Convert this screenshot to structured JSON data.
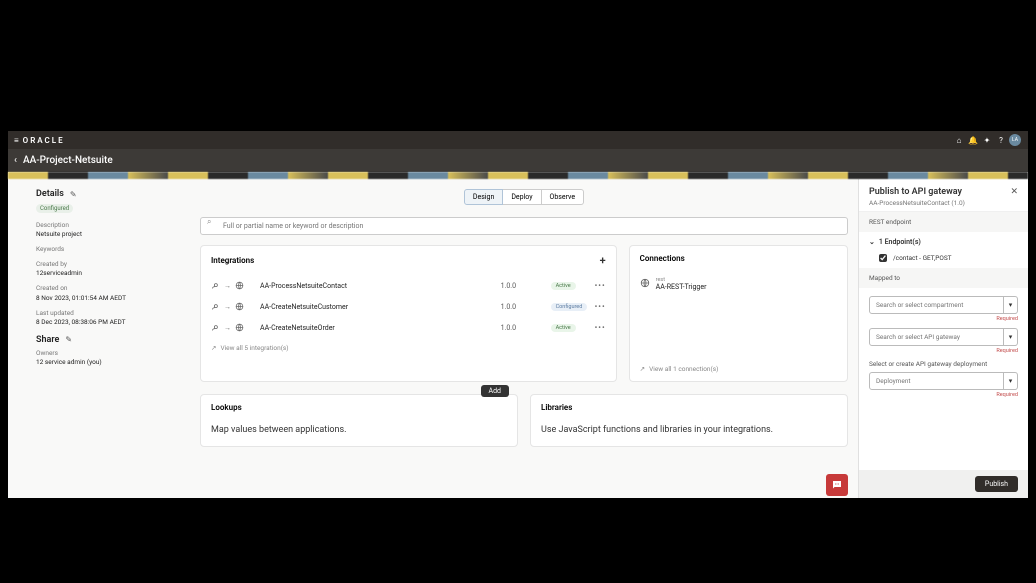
{
  "brand": "ORACLE",
  "userBadge": "LA",
  "pageTitle": "AA-Project-Netsuite",
  "tabs": {
    "design": "Design",
    "deploy": "Deploy",
    "observe": "Observe"
  },
  "search": {
    "placeholder": "Full or partial name or keyword or description"
  },
  "details": {
    "heading": "Details",
    "statusBadge": "Configured",
    "description": {
      "label": "Description",
      "value": "Netsuite project"
    },
    "keywords": {
      "label": "Keywords",
      "value": ""
    },
    "createdBy": {
      "label": "Created by",
      "value": "12serviceadmin"
    },
    "createdOn": {
      "label": "Created on",
      "value": "8 Nov 2023, 01:01:54 AM AEDT"
    },
    "lastUpdated": {
      "label": "Last updated",
      "value": "8 Dec 2023, 08:38:06 PM AEDT"
    },
    "share": {
      "heading": "Share",
      "ownersLabel": "Owners",
      "ownersValue": "12 service admin (you)"
    }
  },
  "integrations": {
    "title": "Integrations",
    "rows": [
      {
        "name": "AA-ProcessNetsuiteContact",
        "version": "1.0.0",
        "status": "Active"
      },
      {
        "name": "AA-CreateNetsuiteCustomer",
        "version": "1.0.0",
        "status": "Configured"
      },
      {
        "name": "AA-CreateNetsuiteOrder",
        "version": "1.0.0",
        "status": "Active"
      }
    ],
    "viewAll": "View all 5 integration(s)"
  },
  "connections": {
    "title": "Connections",
    "rows": [
      {
        "sub": "rest",
        "name": "AA-REST-Trigger"
      }
    ],
    "viewAll": "View all 1 connection(s)"
  },
  "lookups": {
    "title": "Lookups",
    "addLabel": "Add",
    "desc": "Map values between applications."
  },
  "libraries": {
    "title": "Libraries",
    "desc": "Use JavaScript functions and libraries in your integrations."
  },
  "panel": {
    "title": "Publish to API gateway",
    "subtitle": "AA-ProcessNetsuiteContact (1.0)",
    "restEndpointLabel": "REST endpoint",
    "endpointSummary": "1 Endpoint(s)",
    "endpointPath": "/contact - GET,POST",
    "mappedToLabel": "Mapped to",
    "compartmentPlaceholder": "Search or select compartment",
    "gatewayPlaceholder": "Search or select API gateway",
    "requiredText": "Required",
    "deploymentSectionLabel": "Select or create API gateway deployment",
    "deploymentPlaceholder": "Deployment",
    "publishLabel": "Publish"
  }
}
